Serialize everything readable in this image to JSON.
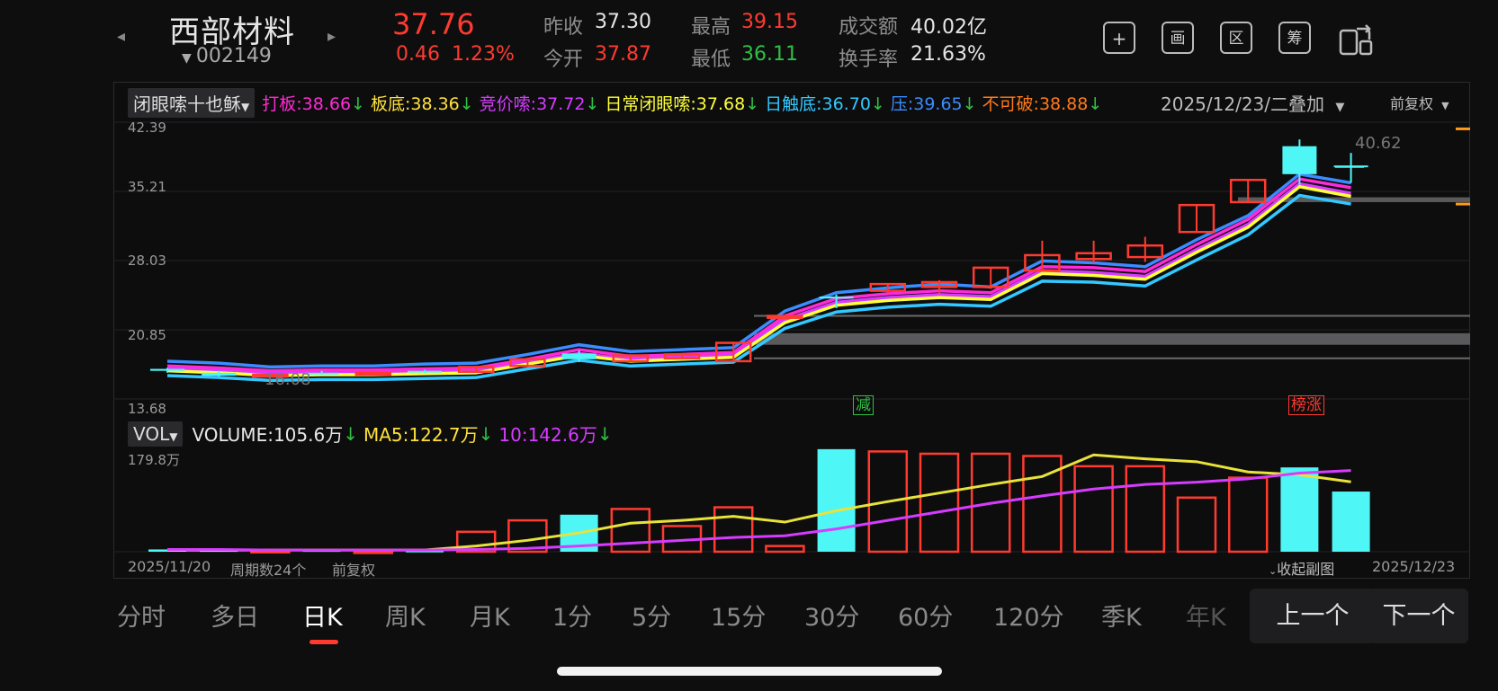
{
  "header": {
    "name": "西部材料",
    "code": "002149",
    "price": "37.76",
    "change": "0.46",
    "change_pct": "1.23%",
    "quote": {
      "prev_close_label": "昨收",
      "prev_close": "37.30",
      "open_label": "今开",
      "open": "37.87",
      "high_label": "最高",
      "high": "39.15",
      "low_label": "最低",
      "low": "36.11",
      "amount_label": "成交额",
      "amount": "40.02亿",
      "turnover_label": "换手率",
      "turnover": "21.63%"
    },
    "tools": [
      "+",
      "画",
      "区",
      "筹"
    ]
  },
  "chart_header": {
    "indicator_select": "闭眼嗦十也稣",
    "lines": [
      {
        "label": "打板:38.66",
        "color": "#ff2bd6"
      },
      {
        "label": "板底:38.36",
        "color": "#ffe13a"
      },
      {
        "label": "竞价嗦:37.72",
        "color": "#d63cff"
      },
      {
        "label": "日常闭眼嗦:37.68",
        "color": "#ffff3a"
      },
      {
        "label": "日触底:36.70",
        "color": "#33c8ff"
      },
      {
        "label": "压:39.65",
        "color": "#3b8cff"
      },
      {
        "label": "不可破:38.88",
        "color": "#ff7a1a"
      }
    ],
    "date_select": "2025/12/23/二叠加",
    "adjust_select": "前复权"
  },
  "price_axis": [
    "42.39",
    "35.21",
    "28.03",
    "20.85",
    "13.68"
  ],
  "chart_annotations": {
    "low_marker": "16.08",
    "high_marker": "40.62",
    "tag_reduce": "减",
    "tag_rank": "榜涨"
  },
  "volume_header": {
    "select": "VOL",
    "volume": "VOLUME:105.6万",
    "ma5": "MA5:122.7万",
    "ma10": "10:142.6万"
  },
  "volume_axis_top": "179.8万",
  "footer": {
    "start_date": "2025/11/20",
    "periods": "周期数24个",
    "adjust": "前复权",
    "collapse": "收起副图",
    "end_date": "2025/12/23"
  },
  "period_tabs": [
    "分时",
    "多日",
    "日K",
    "周K",
    "月K",
    "1分",
    "5分",
    "15分",
    "30分",
    "60分",
    "120分",
    "季K",
    "年K"
  ],
  "active_tab": "日K",
  "nav_buttons": {
    "prev": "上一个",
    "next": "下一个"
  },
  "chart_data": {
    "type": "candlestick",
    "dates_range": [
      "2025/11/20",
      "2025/12/23"
    ],
    "period_count": 24,
    "ylim": [
      13.68,
      42.39
    ],
    "y_ticks": [
      42.39,
      35.21,
      28.03,
      20.85,
      13.68
    ],
    "candles": [
      {
        "o": 16.6,
        "c": 16.8,
        "h": 16.9,
        "l": 16.4,
        "up": false
      },
      {
        "o": 16.4,
        "c": 16.1,
        "h": 16.6,
        "l": 16.0,
        "up": false
      },
      {
        "o": 16.0,
        "c": 16.2,
        "h": 16.3,
        "l": 15.9,
        "up": true
      },
      {
        "o": 16.4,
        "c": 16.3,
        "h": 16.6,
        "l": 16.2,
        "up": false
      },
      {
        "o": 16.2,
        "c": 16.4,
        "h": 16.5,
        "l": 16.1,
        "up": true
      },
      {
        "o": 16.6,
        "c": 16.5,
        "h": 16.7,
        "l": 16.4,
        "up": false
      },
      {
        "o": 16.5,
        "c": 17.0,
        "h": 17.1,
        "l": 16.4,
        "up": true
      },
      {
        "o": 17.1,
        "c": 17.8,
        "h": 17.9,
        "l": 17.0,
        "up": true
      },
      {
        "o": 18.4,
        "c": 17.8,
        "h": 18.7,
        "l": 17.5,
        "up": false
      },
      {
        "o": 17.6,
        "c": 18.2,
        "h": 18.3,
        "l": 17.5,
        "up": true
      },
      {
        "o": 17.9,
        "c": 18.3,
        "h": 18.4,
        "l": 17.8,
        "up": true
      },
      {
        "o": 17.6,
        "c": 19.5,
        "h": 19.5,
        "l": 17.5,
        "up": true
      },
      {
        "o": 22.1,
        "c": 22.3,
        "h": 22.4,
        "l": 22.0,
        "up": true
      },
      {
        "o": 24.3,
        "c": 24.1,
        "h": 24.5,
        "l": 23.1,
        "up": false
      },
      {
        "o": 24.9,
        "c": 25.6,
        "h": 25.7,
        "l": 24.7,
        "up": true
      },
      {
        "o": 25.3,
        "c": 25.8,
        "h": 26.0,
        "l": 24.6,
        "up": true
      },
      {
        "o": 25.3,
        "c": 27.3,
        "h": 27.3,
        "l": 25.1,
        "up": true
      },
      {
        "o": 27.0,
        "c": 28.6,
        "h": 30.1,
        "l": 27.0,
        "up": true
      },
      {
        "o": 28.2,
        "c": 28.8,
        "h": 30.1,
        "l": 27.8,
        "up": true
      },
      {
        "o": 28.4,
        "c": 29.6,
        "h": 30.5,
        "l": 27.9,
        "up": true
      },
      {
        "o": 31.0,
        "c": 33.8,
        "h": 33.8,
        "l": 31.0,
        "up": true
      },
      {
        "o": 34.1,
        "c": 36.4,
        "h": 36.4,
        "l": 34.0,
        "up": true
      },
      {
        "o": 39.9,
        "c": 37.0,
        "h": 40.6,
        "l": 35.9,
        "up": false
      },
      {
        "o": 37.9,
        "c": 37.8,
        "h": 39.2,
        "l": 36.1,
        "up": false
      }
    ],
    "lines": {
      "压": [
        17.6,
        17.4,
        17.0,
        17.1,
        17.1,
        17.3,
        17.4,
        18.3,
        19.3,
        18.6,
        18.8,
        19.0,
        22.8,
        24.7,
        25.2,
        25.6,
        25.3,
        28.0,
        27.8,
        27.4,
        30.2,
        32.7,
        37.0,
        36.1
      ],
      "打板": [
        17.1,
        16.9,
        16.6,
        16.7,
        16.7,
        16.8,
        16.9,
        17.8,
        18.8,
        18.1,
        18.3,
        18.5,
        22.3,
        24.1,
        24.6,
        24.9,
        24.7,
        27.4,
        27.3,
        26.9,
        29.7,
        32.3,
        36.5,
        35.6
      ],
      "板底": [
        16.8,
        16.6,
        16.3,
        16.4,
        16.4,
        16.5,
        16.6,
        17.5,
        18.4,
        17.8,
        18.0,
        18.2,
        21.9,
        23.7,
        24.2,
        24.5,
        24.3,
        27.0,
        26.8,
        26.4,
        29.2,
        31.8,
        36.0,
        35.0
      ],
      "日常闭眼嗦": [
        16.6,
        16.4,
        16.1,
        16.2,
        16.2,
        16.3,
        16.4,
        17.3,
        18.2,
        17.6,
        17.8,
        18.0,
        21.6,
        23.4,
        23.9,
        24.2,
        24.0,
        26.7,
        26.5,
        26.1,
        28.9,
        31.5,
        35.7,
        34.7
      ],
      "日触底": [
        16.1,
        15.9,
        15.6,
        15.7,
        15.7,
        15.8,
        15.9,
        16.8,
        17.7,
        17.1,
        17.3,
        17.5,
        21.0,
        22.7,
        23.2,
        23.5,
        23.3,
        25.9,
        25.8,
        25.4,
        28.1,
        30.7,
        34.8,
        33.9
      ]
    },
    "volume": {
      "ylim": [
        0,
        179.8
      ],
      "unit": "万",
      "bars": [
        4,
        3,
        2,
        3,
        1,
        2,
        35,
        55,
        65,
        75,
        45,
        78,
        10,
        180,
        176,
        172,
        172,
        168,
        150,
        150,
        95,
        130,
        148,
        105.6
      ],
      "up": [
        false,
        false,
        true,
        false,
        true,
        false,
        true,
        true,
        false,
        true,
        true,
        true,
        true,
        false,
        true,
        true,
        true,
        true,
        true,
        true,
        true,
        true,
        false,
        false
      ],
      "ma5": [
        3,
        3,
        3,
        3,
        3,
        3,
        10,
        20,
        33,
        50,
        55,
        62,
        52,
        72,
        88,
        103,
        118,
        132,
        170,
        163,
        158,
        140,
        135,
        122.7
      ],
      "ma10": [
        4,
        4,
        3,
        3,
        3,
        3,
        4,
        6,
        10,
        15,
        20,
        25,
        28,
        40,
        55,
        70,
        85,
        98,
        110,
        118,
        122,
        128,
        138,
        142.6
      ]
    }
  }
}
